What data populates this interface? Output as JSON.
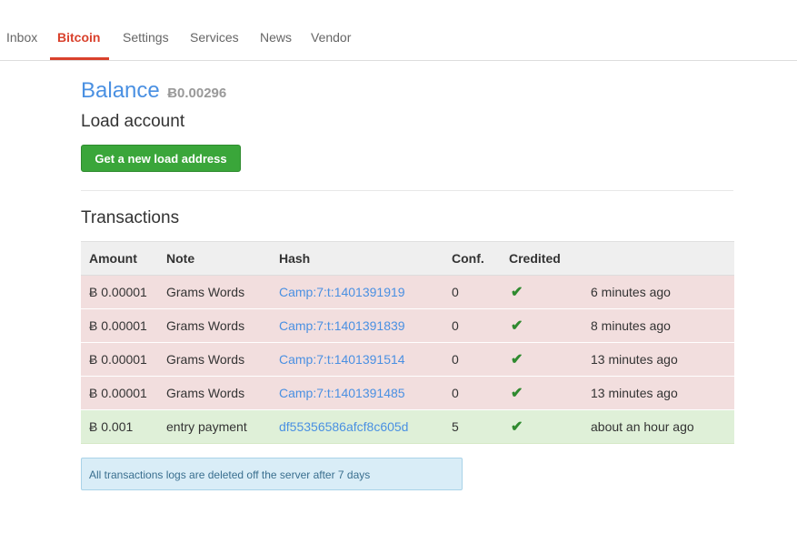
{
  "nav": {
    "tabs": [
      "Inbox",
      "Bitcoin",
      "Settings",
      "Services",
      "News",
      "Vendor"
    ],
    "active": "Bitcoin"
  },
  "balance": {
    "title": "Balance",
    "amount": "Ƀ0.00296"
  },
  "load": {
    "title": "Load account",
    "button_label": "Get a new load address"
  },
  "transactions": {
    "title": "Transactions",
    "headers": [
      "Amount",
      "Note",
      "Hash",
      "Conf.",
      "Credited",
      ""
    ],
    "rows": [
      {
        "amount": "Ƀ 0.00001",
        "note": "Grams Words",
        "hash": "Camp:7:t:1401391919",
        "conf": "0",
        "credited": "✔",
        "time": "6 minutes ago",
        "status": "pending"
      },
      {
        "amount": "Ƀ 0.00001",
        "note": "Grams Words",
        "hash": "Camp:7:t:1401391839",
        "conf": "0",
        "credited": "✔",
        "time": "8 minutes ago",
        "status": "pending"
      },
      {
        "amount": "Ƀ 0.00001",
        "note": "Grams Words",
        "hash": "Camp:7:t:1401391514",
        "conf": "0",
        "credited": "✔",
        "time": "13 minutes ago",
        "status": "pending"
      },
      {
        "amount": "Ƀ 0.00001",
        "note": "Grams Words",
        "hash": "Camp:7:t:1401391485",
        "conf": "0",
        "credited": "✔",
        "time": "13 minutes ago",
        "status": "pending"
      },
      {
        "amount": "Ƀ 0.001",
        "note": "entry payment",
        "hash": "df55356586afcf8c605d",
        "conf": "5",
        "credited": "✔",
        "time": "about an hour ago",
        "status": "done"
      }
    ]
  },
  "notice": "All transactions logs are deleted off the server after 7 days",
  "colors": {
    "accent": "#d9412c",
    "link": "#4a90e2",
    "button": "#3aa63a",
    "pending_row": "#f2dede",
    "done_row": "#dff0d8",
    "notice_bg": "#d9edf7"
  }
}
